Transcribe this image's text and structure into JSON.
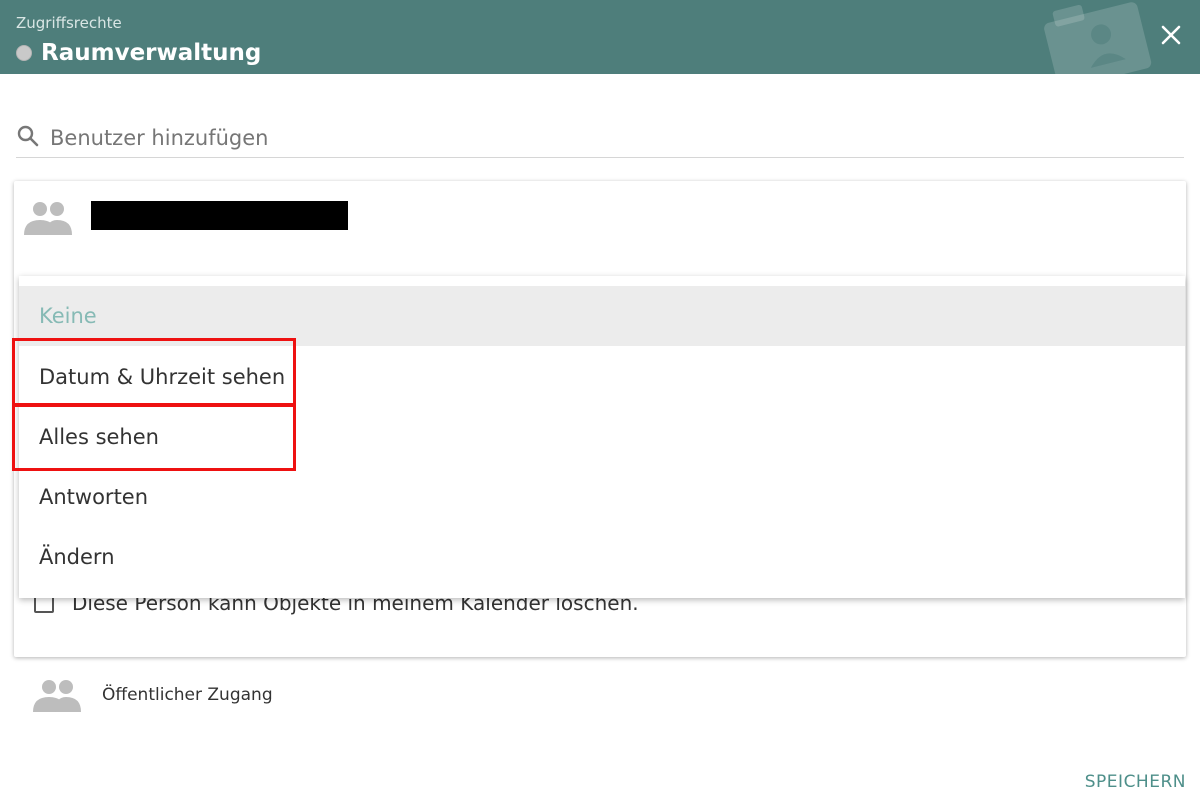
{
  "header": {
    "subtitle": "Zugriffsrechte",
    "title": "Raumverwaltung",
    "close_icon": "close-icon",
    "decor_icon": "contact-card-icon"
  },
  "search": {
    "placeholder": "Benutzer hinzufügen",
    "value": "",
    "icon": "search-icon"
  },
  "user_card": {
    "icon": "group-icon",
    "name": "",
    "checkbox_label": "Diese Person kann Objekte in meinem Kalender löschen.",
    "checkbox_checked": false
  },
  "permission_dropdown": {
    "selected": "Keine",
    "options": [
      {
        "label": "Keine"
      },
      {
        "label": "Datum & Uhrzeit sehen"
      },
      {
        "label": "Alles sehen"
      },
      {
        "label": "Antworten"
      },
      {
        "label": "Ändern"
      }
    ]
  },
  "public_access": {
    "icon": "group-icon",
    "label": "Öffentlicher Zugang"
  },
  "footer": {
    "save_label": "SPEICHERN"
  },
  "colors": {
    "header_bg": "#4e7e7b",
    "accent": "#4e8f8a",
    "selected_text": "#86bab5",
    "highlight": "#ee1111"
  }
}
